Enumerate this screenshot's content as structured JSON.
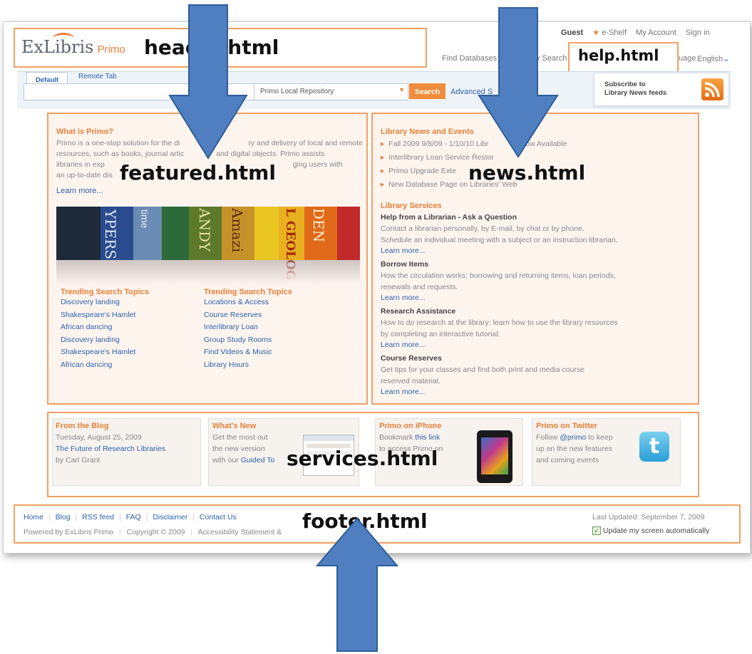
{
  "header": {
    "brand_ex": "ExLibris",
    "brand_primo": "Primo",
    "label": "header.html",
    "top_links": [
      "Guest",
      "e-Shelf",
      "My Account",
      "Sign in"
    ],
    "sub_links": [
      "Find Databases",
      "y Search",
      "uage",
      "English"
    ],
    "help_label": "help.html"
  },
  "search": {
    "tab_default": "Default",
    "tab_remote": "Remote Tab",
    "scope": "Primo Local Repository",
    "button": "Search",
    "advanced": "Advanced S",
    "rss_line1": "Subscribe to",
    "rss_line2": "Library News feeds"
  },
  "featured": {
    "label": "featured.html",
    "title": "What is Primo?",
    "desc1": "Primo is a one-stop solution for the di",
    "desc1b": "ry and delivery of local and remote",
    "desc2": "resources, such as books, journal artic",
    "desc2b": "and digital objects. Primo assists",
    "desc3": "libraries in exp",
    "desc3b": "ging users with",
    "desc4": "an up-to-date dis",
    "learn_more": "Learn more...",
    "book_titles": [
      "YPERS",
      "time",
      "ANDY",
      "Amazi",
      "L GEOLOG",
      "DEN"
    ],
    "col1_title": "Trending Search Topics",
    "col1": [
      "Discovery landing",
      "Shakespeare's Hamlet",
      "African dancing",
      "Discovery landing",
      "Shakespeare's Hamlet",
      "African dancing"
    ],
    "col2_title": "Trending Search Topics",
    "col2": [
      "Locations & Access",
      "Course Reserves",
      "Interlibrary Loan",
      "Group Study Rooms",
      "Find Videos & Music",
      "Library Hours"
    ]
  },
  "news": {
    "label": "news.html",
    "title": "Library News and Events",
    "items": [
      "Fall 2009 9/8/09 - 1/10/10 Libr",
      "Interlibrary Loan Service Restor",
      "Primo Upgrade Exte",
      "New Database Page on Libraries' Web"
    ],
    "item1_tail": "s Now Available",
    "services_title": "Library Services",
    "sections": [
      {
        "title": "Help from a Librarian - Ask a Question",
        "lines": [
          "Contact a librarian personally, by E-mail, by chat or by phone.",
          "Schedule an individual meeting with a subject or an instruction librarian."
        ],
        "more": "Learn more..."
      },
      {
        "title": "Borrow Items",
        "lines": [
          "How the circulation works: borrowing and returning items, loan periods,",
          "renewals and requests."
        ],
        "more": "Learn more..."
      },
      {
        "title": "Research Assistance",
        "lines": [
          "How to do research at the library: learn how to use the library resources",
          "by completing an interactive tutorial."
        ],
        "more": "Learn more..."
      },
      {
        "title": "Course Reserves",
        "lines": [
          "Get tips for your classes and find both print and media course",
          "reserved material."
        ],
        "more": "Learn more..."
      }
    ]
  },
  "services": {
    "label": "services.html",
    "blog_title": "From the Blog",
    "blog_date": "Tuesday, August 25, 2009",
    "blog_link": "The Future of Research Libraries",
    "blog_author": "by Carl Grant",
    "new_title": "What's New",
    "new_line1": "Get the most out",
    "new_line2": "the new version",
    "new_line3": "with our ",
    "new_link": "Guided To",
    "iphone_title": "Primo on iPhone",
    "iphone_line1": "Bookmark ",
    "iphone_link": "this link",
    "iphone_line2": "to access Primo on",
    "twitter_title": "Primo on Twitter",
    "twitter_line1": "Follow ",
    "twitter_link": "@primo",
    "twitter_line1b": " to keep",
    "twitter_line2": "up on the new features",
    "twitter_line3": "and coming events"
  },
  "footer": {
    "label": "footer.html",
    "links": [
      "Home",
      "Blog",
      "RSS feed",
      "FAQ",
      "Disclaimer",
      "Contact Us"
    ],
    "powered": "Powered by ExLibris Primo",
    "copyright": "Copyright © 2009",
    "accessibility": "Accessibility Statement &",
    "last_updated": "Last Updated: September 7, 2009",
    "update_auto": "Update my screen automatically"
  },
  "colors": {
    "accent": "#e8803a",
    "link": "#2c62b0",
    "arrow": "#4f7fc0",
    "box_border": "#f0a064"
  }
}
